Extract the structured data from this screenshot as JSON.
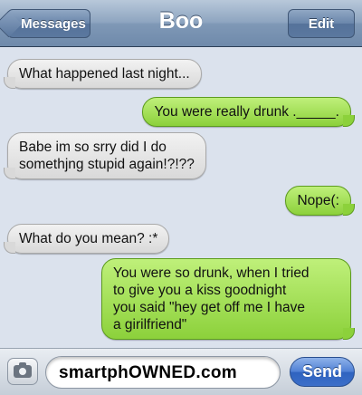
{
  "navbar": {
    "back_label": "Messages",
    "title": "Boo",
    "edit_label": "Edit"
  },
  "messages": [
    {
      "direction": "received",
      "text": "What happened last night..."
    },
    {
      "direction": "sent",
      "text": "You were really drunk ._____."
    },
    {
      "direction": "received",
      "text": "Babe im so srry did I do\nsomethjng stupid again!?!??"
    },
    {
      "direction": "sent",
      "text": "Nope(:"
    },
    {
      "direction": "received",
      "text": "What do you mean? :*"
    },
    {
      "direction": "sent",
      "text": "You were so drunk, when I tried\nto give you a kiss goodnight\nyou said \"hey get off me I have\na girilfriend\""
    }
  ],
  "input_bar": {
    "camera_icon": "camera-icon",
    "text_value": "smartphOWNED.com",
    "send_label": "Send"
  },
  "colors": {
    "sent_bubble": "#8cd13b",
    "received_bubble": "#e6e6e6",
    "background": "#dbe2ed",
    "send_button": "#3c6fc9"
  }
}
